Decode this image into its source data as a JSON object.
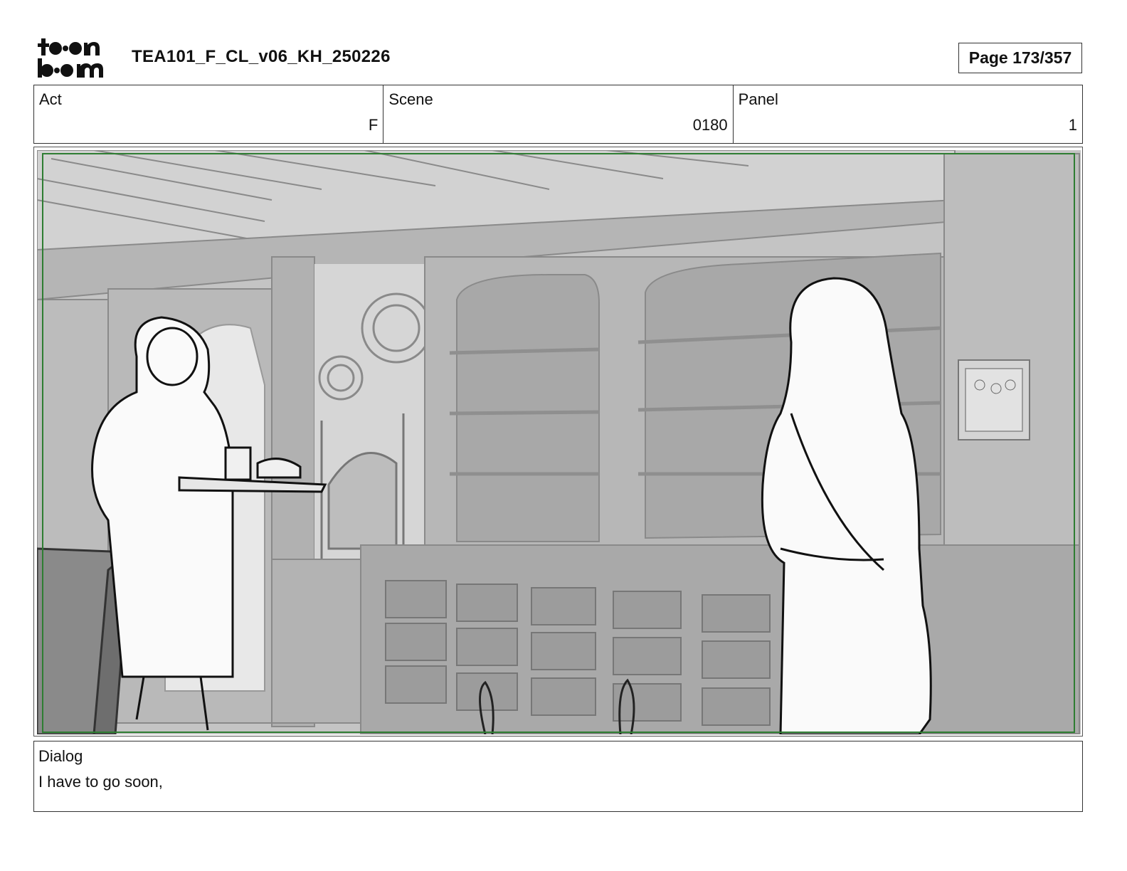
{
  "header": {
    "logo_text": "toonboom",
    "doc_title": "TEA101_F_CL_v06_KH_250226",
    "page_label": "Page 173/357"
  },
  "info": {
    "act_label": "Act",
    "act_value": "F",
    "scene_label": "Scene",
    "scene_value": "0180",
    "panel_label": "Panel",
    "panel_value": "1"
  },
  "panel": {
    "safe_frame_color": "#2e7d32"
  },
  "dialog": {
    "label": "Dialog",
    "text": "I have to go soon,"
  }
}
